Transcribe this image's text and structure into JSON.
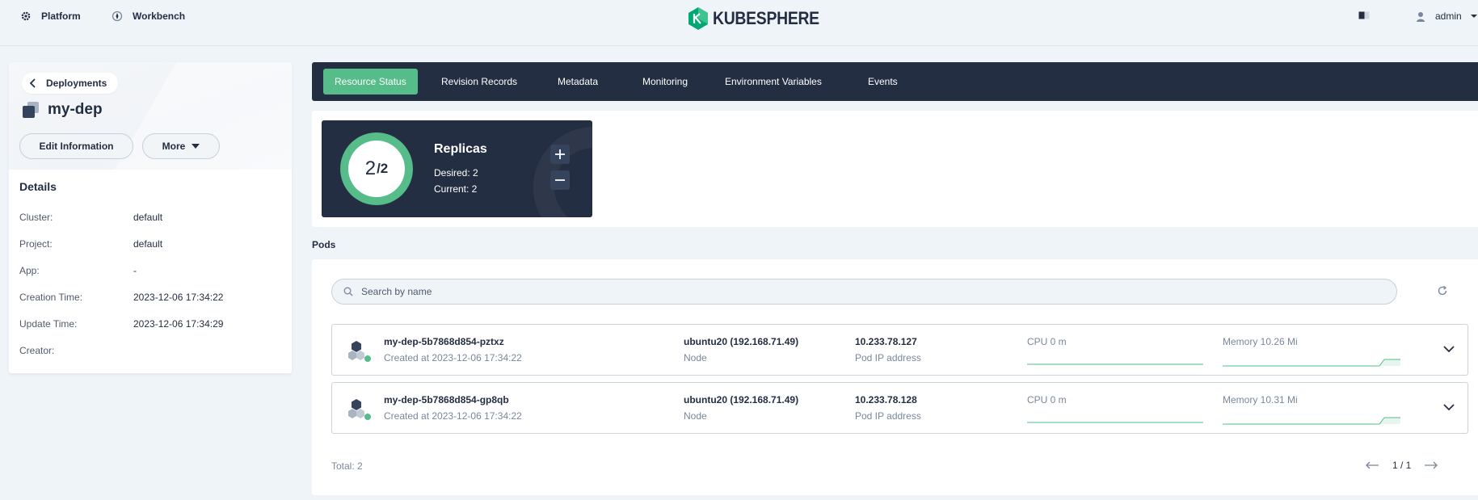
{
  "topbar": {
    "platform_label": "Platform",
    "workbench_label": "Workbench",
    "logo_text": "KUBESPHERE",
    "user_name": "admin"
  },
  "colors": {
    "accent": "#55bc8a",
    "dark": "#242e42",
    "background": "#eff4f9"
  },
  "left_panel": {
    "back_label": "Deployments",
    "deployment_name": "my-dep",
    "edit_button": "Edit Information",
    "more_button": "More",
    "details_title": "Details",
    "details": [
      {
        "key": "Cluster:",
        "value": "default"
      },
      {
        "key": "Project:",
        "value": "default"
      },
      {
        "key": "App:",
        "value": "-"
      },
      {
        "key": "Creation Time:",
        "value": "2023-12-06 17:34:22"
      },
      {
        "key": "Update Time:",
        "value": "2023-12-06 17:34:29"
      },
      {
        "key": "Creator:",
        "value": ""
      }
    ]
  },
  "tabs": [
    {
      "label": "Resource Status",
      "active": true
    },
    {
      "label": "Revision Records",
      "active": false
    },
    {
      "label": "Metadata",
      "active": false
    },
    {
      "label": "Monitoring",
      "active": false
    },
    {
      "label": "Environment Variables",
      "active": false
    },
    {
      "label": "Events",
      "active": false
    }
  ],
  "replicas": {
    "ready": "2",
    "total": "/2",
    "title": "Replicas",
    "desired": "Desired: 2",
    "current": "Current: 2",
    "fraction_ready": 1.0
  },
  "pods": {
    "section_label": "Pods",
    "search_placeholder": "Search by name",
    "items": [
      {
        "name": "my-dep-5b7868d854-pztxz",
        "created": "Created at 2023-12-06 17:34:22",
        "node": "ubuntu20 (192.168.71.49)",
        "node_label": "Node",
        "ip": "10.233.78.127",
        "ip_label": "Pod IP address",
        "cpu": "CPU 0 m",
        "memory": "Memory 10.26 Mi",
        "status_color": "#55bc8a"
      },
      {
        "name": "my-dep-5b7868d854-gp8qb",
        "created": "Created at 2023-12-06 17:34:22",
        "node": "ubuntu20 (192.168.71.49)",
        "node_label": "Node",
        "ip": "10.233.78.128",
        "ip_label": "Pod IP address",
        "cpu": "CPU 0 m",
        "memory": "Memory 10.31 Mi",
        "status_color": "#55bc8a"
      }
    ],
    "total": "Total: 2",
    "page": "1 / 1"
  }
}
